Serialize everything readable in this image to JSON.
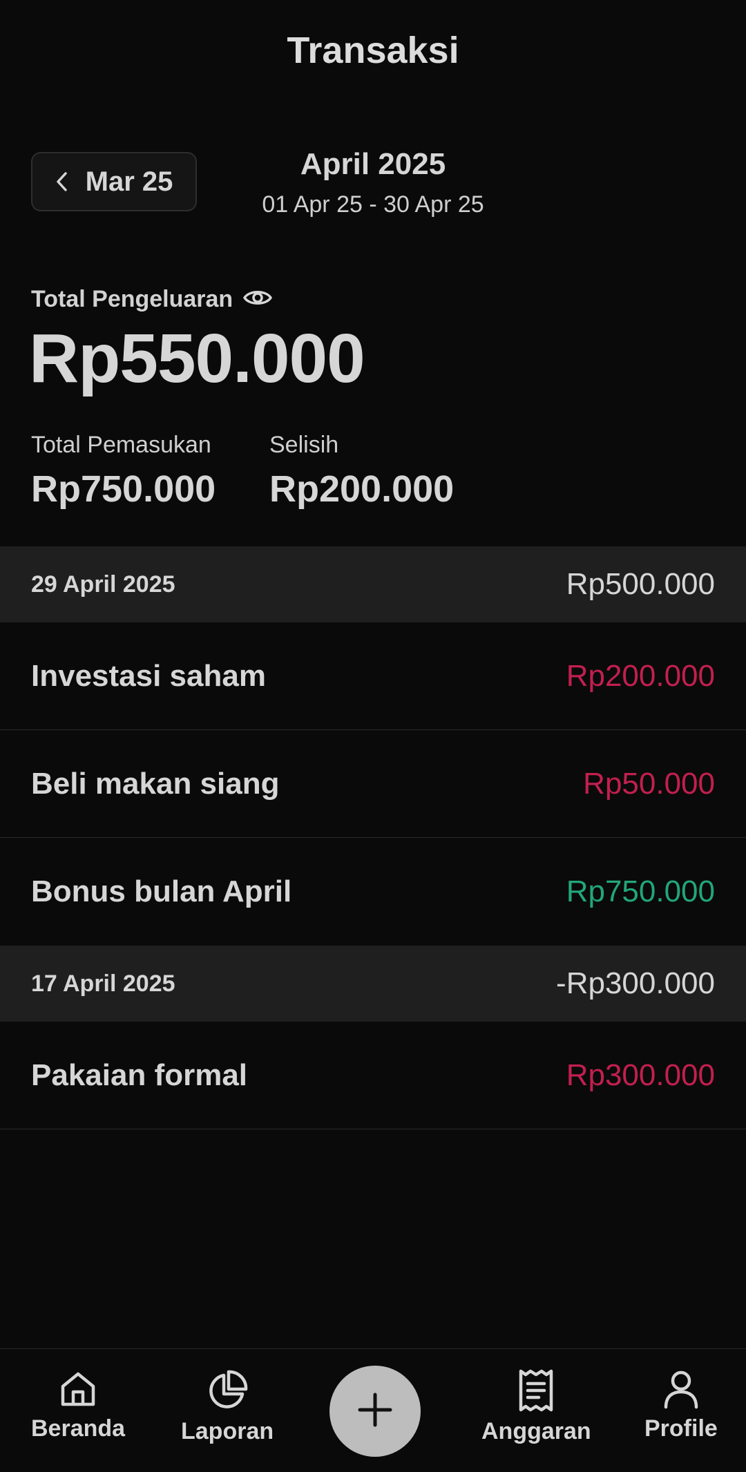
{
  "header": {
    "title": "Transaksi"
  },
  "period": {
    "prev_label": "Mar 25",
    "month": "April 2025",
    "range": "01 Apr 25 - 30 Apr 25"
  },
  "summary": {
    "expense_label": "Total Pengeluaran",
    "expense_amount": "Rp550.000",
    "income_label": "Total Pemasukan",
    "income_amount": "Rp750.000",
    "diff_label": "Selisih",
    "diff_amount": "Rp200.000"
  },
  "groups": [
    {
      "date": "29 April 2025",
      "total": "Rp500.000",
      "items": [
        {
          "name": "Investasi saham",
          "amount": "Rp200.000",
          "type": "expense"
        },
        {
          "name": "Beli makan siang",
          "amount": "Rp50.000",
          "type": "expense"
        },
        {
          "name": "Bonus bulan April",
          "amount": "Rp750.000",
          "type": "income"
        }
      ]
    },
    {
      "date": "17 April 2025",
      "total": "-Rp300.000",
      "items": [
        {
          "name": "Pakaian formal",
          "amount": "Rp300.000",
          "type": "expense"
        }
      ]
    }
  ],
  "nav": {
    "items": [
      {
        "label": "Beranda",
        "icon": "home-icon"
      },
      {
        "label": "Laporan",
        "icon": "pie-chart-icon"
      },
      {
        "label": "Anggaran",
        "icon": "receipt-icon"
      },
      {
        "label": "Profile",
        "icon": "person-icon"
      }
    ],
    "fab_icon": "plus-icon"
  },
  "colors": {
    "background": "#0a0a0a",
    "expense": "#c21f4f",
    "income": "#22a67a",
    "group_header": "#1f1f1f"
  }
}
